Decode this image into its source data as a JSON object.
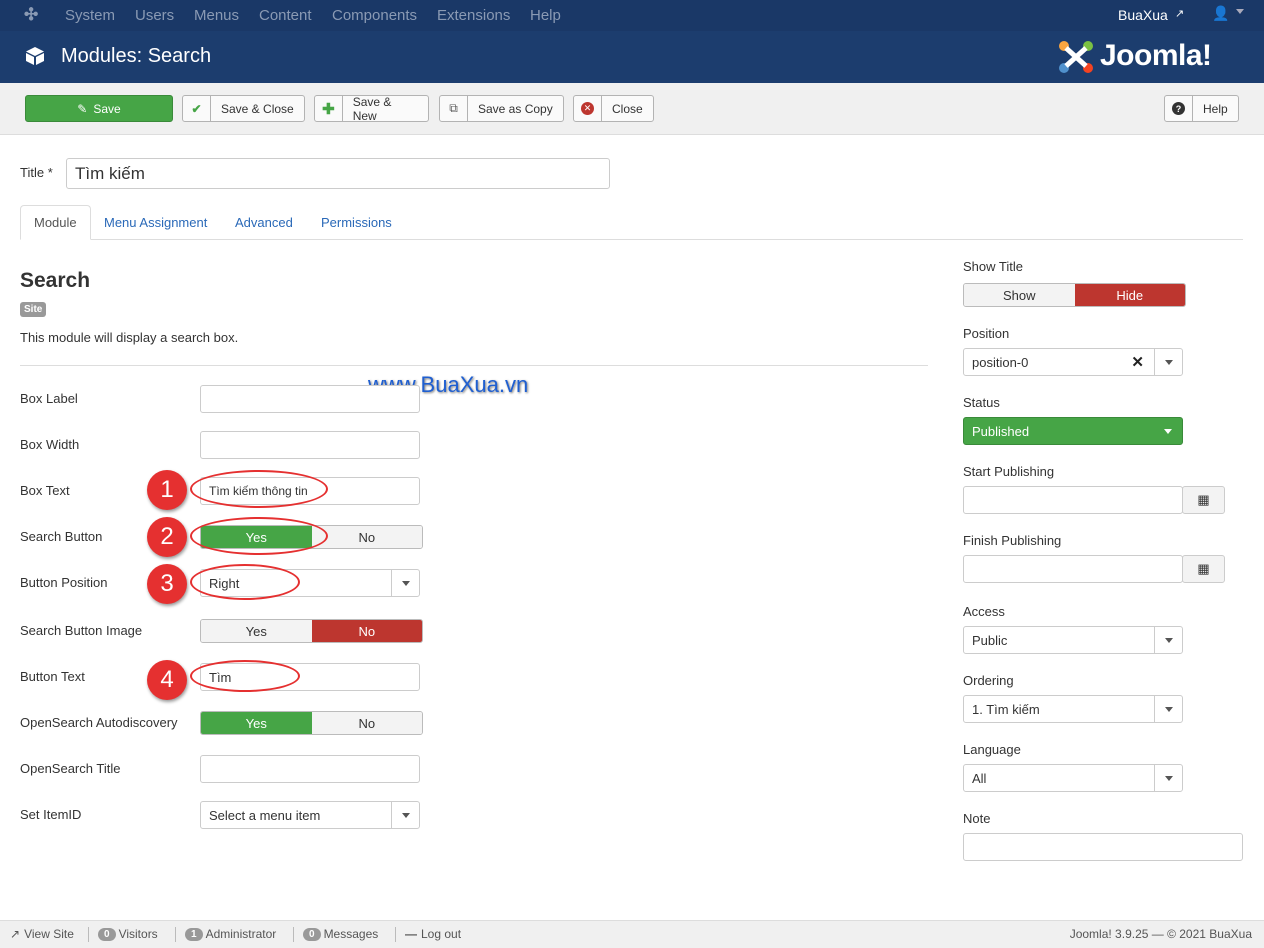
{
  "topnav": {
    "menu": [
      "System",
      "Users",
      "Menus",
      "Content",
      "Components",
      "Extensions",
      "Help"
    ],
    "site_name": "BuaXua"
  },
  "header": {
    "title": "Modules: Search",
    "brand": "Joomla!"
  },
  "toolbar": {
    "save": "Save",
    "save_close": "Save & Close",
    "save_new": "Save & New",
    "save_copy": "Save as Copy",
    "close": "Close",
    "help": "Help"
  },
  "form": {
    "title_label": "Title *",
    "title_value": "Tìm kiếm"
  },
  "tabs": [
    "Module",
    "Menu Assignment",
    "Advanced",
    "Permissions"
  ],
  "module": {
    "heading": "Search",
    "badge": "Site",
    "description": "This module will display a search box."
  },
  "watermark": "www.BuaXua.vn",
  "fields": {
    "box_label": {
      "label": "Box Label",
      "value": ""
    },
    "box_width": {
      "label": "Box Width",
      "value": ""
    },
    "box_text": {
      "label": "Box Text",
      "value": "Tìm kiếm thông tin"
    },
    "search_button": {
      "label": "Search Button",
      "yes": "Yes",
      "no": "No",
      "selected": "Yes"
    },
    "button_position": {
      "label": "Button Position",
      "value": "Right"
    },
    "search_button_image": {
      "label": "Search Button Image",
      "yes": "Yes",
      "no": "No",
      "selected": "No"
    },
    "button_text": {
      "label": "Button Text",
      "value": "Tìm"
    },
    "opensearch_auto": {
      "label": "OpenSearch Autodiscovery",
      "yes": "Yes",
      "no": "No",
      "selected": "Yes"
    },
    "opensearch_title": {
      "label": "OpenSearch Title",
      "value": ""
    },
    "set_itemid": {
      "label": "Set ItemID",
      "value": "Select a menu item"
    }
  },
  "annotations": [
    "1",
    "2",
    "3",
    "4"
  ],
  "sidebar": {
    "show_title": {
      "label": "Show Title",
      "show": "Show",
      "hide": "Hide",
      "selected": "Hide"
    },
    "position": {
      "label": "Position",
      "value": "position-0"
    },
    "status": {
      "label": "Status",
      "value": "Published"
    },
    "start_publishing": {
      "label": "Start Publishing",
      "value": ""
    },
    "finish_publishing": {
      "label": "Finish Publishing",
      "value": ""
    },
    "access": {
      "label": "Access",
      "value": "Public"
    },
    "ordering": {
      "label": "Ordering",
      "value": "1. Tìm kiếm"
    },
    "language": {
      "label": "Language",
      "value": "All"
    },
    "note": {
      "label": "Note",
      "value": ""
    }
  },
  "footer": {
    "view_site": "View Site",
    "visitors_count": "0",
    "visitors": "Visitors",
    "admin_count": "1",
    "administrator": "Administrator",
    "messages_count": "0",
    "messages": "Messages",
    "logout": "Log out",
    "version": "Joomla! 3.9.25 — © 2021 BuaXua"
  },
  "colors": {
    "nav_bg": "#1a3867",
    "header_bg": "#1c3d6e",
    "green": "#46a546",
    "red": "#bd362f",
    "link": "#2a69b8",
    "annotation": "#e53030"
  }
}
